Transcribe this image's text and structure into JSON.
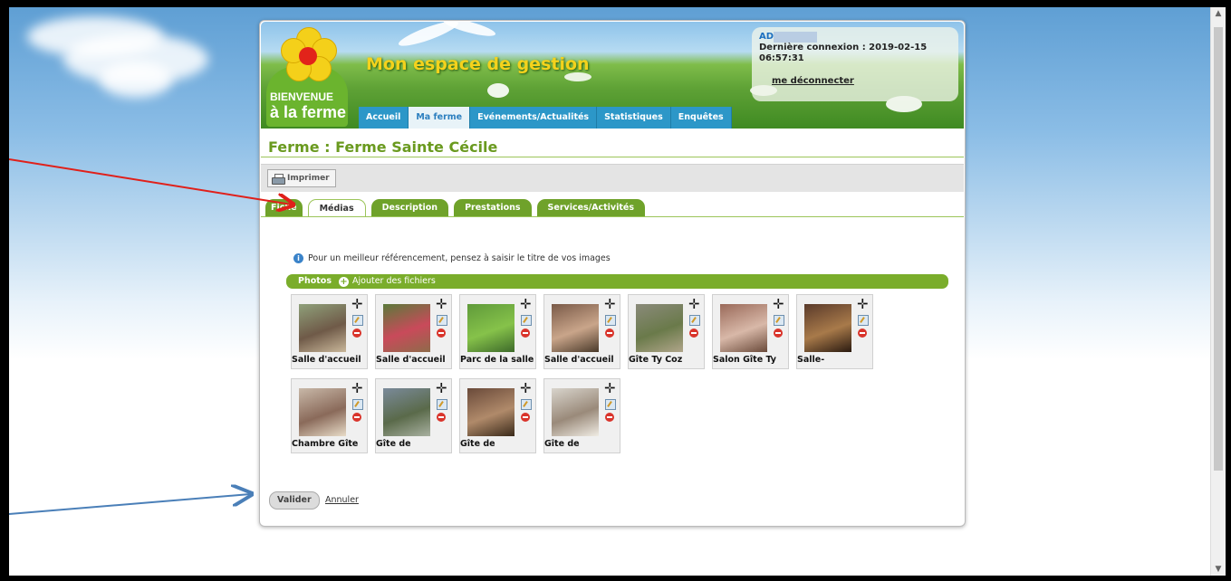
{
  "header": {
    "title": "Mon espace de gestion",
    "logo_line1": "BIENVENUE",
    "logo_line2": "à la ferme"
  },
  "user": {
    "name": "AD",
    "last_login": "Dernière connexion : 2019-02-15 06:57:31",
    "logout_label": "me déconnecter"
  },
  "nav": {
    "tabs": [
      "Accueil",
      "Ma ferme",
      "Evénements/Actualités",
      "Statistiques",
      "Enquêtes"
    ],
    "active": "Ma ferme"
  },
  "page": {
    "title": "Ferme : Ferme Sainte Cécile",
    "print_label": "Imprimer"
  },
  "subtabs": {
    "tabs": [
      "Fiche",
      "Médias",
      "Description",
      "Prestations",
      "Services/Activités"
    ],
    "active": "Médias"
  },
  "media": {
    "tip": "Pour un meilleur référencement, pensez à saisir le titre de vos images",
    "photos_label": "Photos",
    "add_files_label": "Ajouter des fichiers",
    "photos": [
      {
        "caption": "Salle d'accueil"
      },
      {
        "caption": "Salle d'accueil"
      },
      {
        "caption": "Parc de la salle"
      },
      {
        "caption": "Salle d'accueil"
      },
      {
        "caption": "Gîte Ty Coz"
      },
      {
        "caption": "Salon Gîte Ty"
      },
      {
        "caption": "Salle-"
      },
      {
        "caption": "Chambre Gîte"
      },
      {
        "caption": "Gîte de"
      },
      {
        "caption": "Gîte de"
      },
      {
        "caption": "Gîte de"
      }
    ]
  },
  "actions": {
    "validate_label": "Valider",
    "cancel_label": "Annuler"
  },
  "colors": {
    "accent_green": "#6fa22a",
    "nav_blue": "#2c97c8",
    "title_green": "#6a9a1f",
    "annotation_red": "#e0201a",
    "annotation_blue": "#4a7fb8"
  }
}
